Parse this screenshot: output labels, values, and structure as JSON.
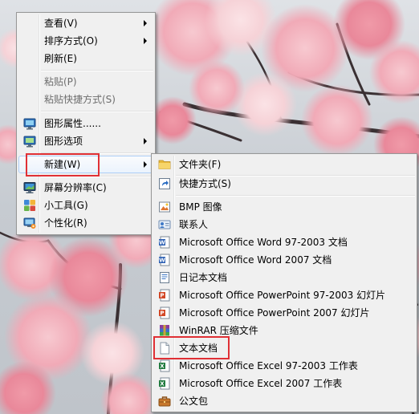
{
  "main_menu": {
    "items": [
      {
        "label": "查看(V)",
        "has_submenu": true
      },
      {
        "label": "排序方式(O)",
        "has_submenu": true
      },
      {
        "label": "刷新(E)"
      },
      {
        "label": "粘贴(P)",
        "disabled": true
      },
      {
        "label": "粘贴快捷方式(S)",
        "disabled": true
      },
      {
        "label": "图形属性......",
        "icon": "graphics-properties-icon"
      },
      {
        "label": "图形选项",
        "icon": "graphics-options-icon",
        "has_submenu": true
      },
      {
        "label": "新建(W)",
        "has_submenu": true,
        "highlighted": true
      },
      {
        "label": "屏幕分辨率(C)",
        "icon": "screen-resolution-icon"
      },
      {
        "label": "小工具(G)",
        "icon": "gadgets-icon"
      },
      {
        "label": "个性化(R)",
        "icon": "personalize-icon"
      }
    ]
  },
  "new_submenu": {
    "items": [
      {
        "label": "文件夹(F)",
        "icon": "folder-icon"
      },
      {
        "label": "快捷方式(S)",
        "icon": "shortcut-icon"
      },
      {
        "label": "BMP 图像",
        "icon": "bmp-image-icon"
      },
      {
        "label": "联系人",
        "icon": "contact-icon"
      },
      {
        "label": "Microsoft Office Word 97-2003 文档",
        "icon": "word-icon"
      },
      {
        "label": "Microsoft Office Word 2007 文档",
        "icon": "word-icon"
      },
      {
        "label": "日记本文档",
        "icon": "journal-icon"
      },
      {
        "label": "Microsoft Office PowerPoint 97-2003 幻灯片",
        "icon": "powerpoint-icon"
      },
      {
        "label": "Microsoft Office PowerPoint 2007 幻灯片",
        "icon": "powerpoint-icon"
      },
      {
        "label": "WinRAR 压缩文件",
        "icon": "winrar-icon"
      },
      {
        "label": "文本文档",
        "icon": "text-document-icon"
      },
      {
        "label": "Microsoft Office Excel 97-2003 工作表",
        "icon": "excel-icon"
      },
      {
        "label": "Microsoft Office Excel 2007 工作表",
        "icon": "excel-icon"
      },
      {
        "label": "公文包",
        "icon": "briefcase-icon"
      }
    ]
  },
  "annotations": {
    "box_color": "#e03035",
    "boxed_items": [
      "新建(W)",
      "文本文档"
    ]
  }
}
